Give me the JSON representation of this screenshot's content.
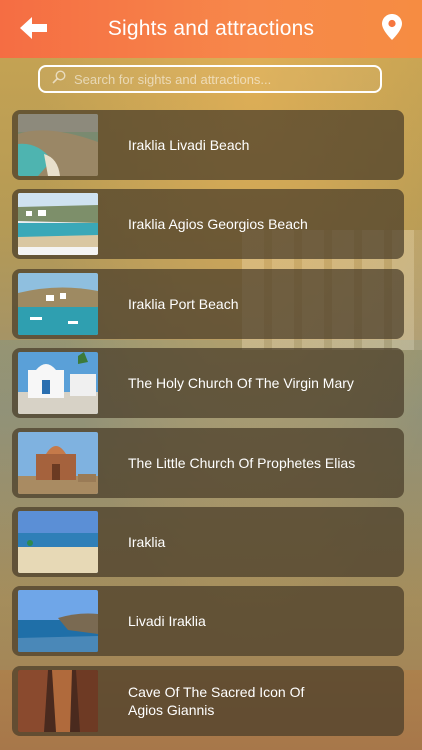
{
  "header": {
    "title": "Sights and attractions",
    "back_icon": "arrow-left-icon",
    "map_icon": "map-pin-icon",
    "color": "#f6763f"
  },
  "search": {
    "placeholder": "Search for sights and attractions...",
    "value": "",
    "icon": "search-icon"
  },
  "items": [
    {
      "label": "Iraklia Livadi Beach"
    },
    {
      "label": "Iraklia Agios Georgios Beach"
    },
    {
      "label": "Iraklia Port Beach"
    },
    {
      "label": "The Holy Church Of The Virgin Mary"
    },
    {
      "label": "The Little Church Of Prophetes Elias"
    },
    {
      "label": "Iraklia"
    },
    {
      "label": "Livadi Iraklia"
    },
    {
      "label": "Cave Of The Sacred Icon Of\nAgios Giannis"
    }
  ]
}
